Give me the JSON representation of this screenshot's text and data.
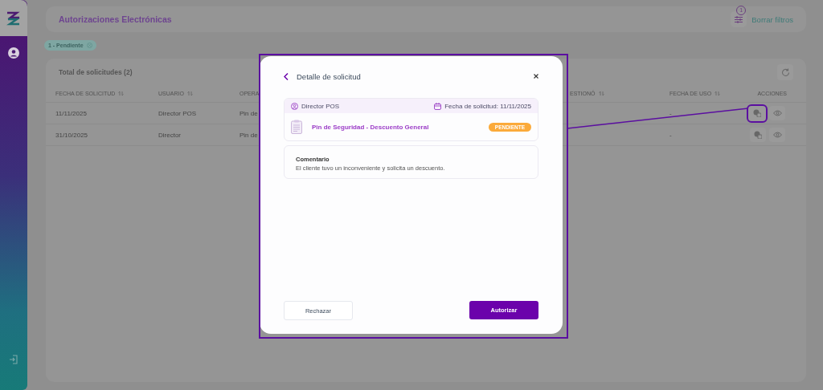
{
  "header": {
    "title": "Autorizaciones Electrónicas",
    "filter_count": "1",
    "clear_filters": "Borrar filtros"
  },
  "filter_chips": [
    {
      "label": "1 - Pendiente"
    }
  ],
  "table": {
    "title": "Total de solicitudes (2)",
    "columns": [
      {
        "label": "FECHA DE SOLICITUD",
        "sortable": true
      },
      {
        "label": "USUARIO",
        "sortable": true
      },
      {
        "label": "OPERA",
        "sortable": false
      },
      {
        "label": "ESTIONÓ",
        "sortable": true
      },
      {
        "label": "FECHA DE USO",
        "sortable": true
      },
      {
        "label": "ACCIONES",
        "sortable": false
      }
    ],
    "rows": [
      {
        "cells": [
          "11/11/2025",
          "Director POS",
          "Pin de",
          "",
          "-"
        ],
        "annotated": true
      },
      {
        "cells": [
          "31/10/2025",
          "Director",
          "Pin de",
          "",
          "-"
        ],
        "annotated": false
      }
    ]
  },
  "modal": {
    "title": "Detalle de solicitud",
    "user": "Director POS",
    "date": "Fecha de solicitud: 11/11/2025",
    "operation": "Pin de Seguridad - Descuento General",
    "status": "PENDIENTE",
    "comment_label": "Comentario",
    "comment": "El cliente tuvo un inconveniente y solicita un descuento.",
    "reject": "Rechazar",
    "approve": "Autorizar"
  }
}
